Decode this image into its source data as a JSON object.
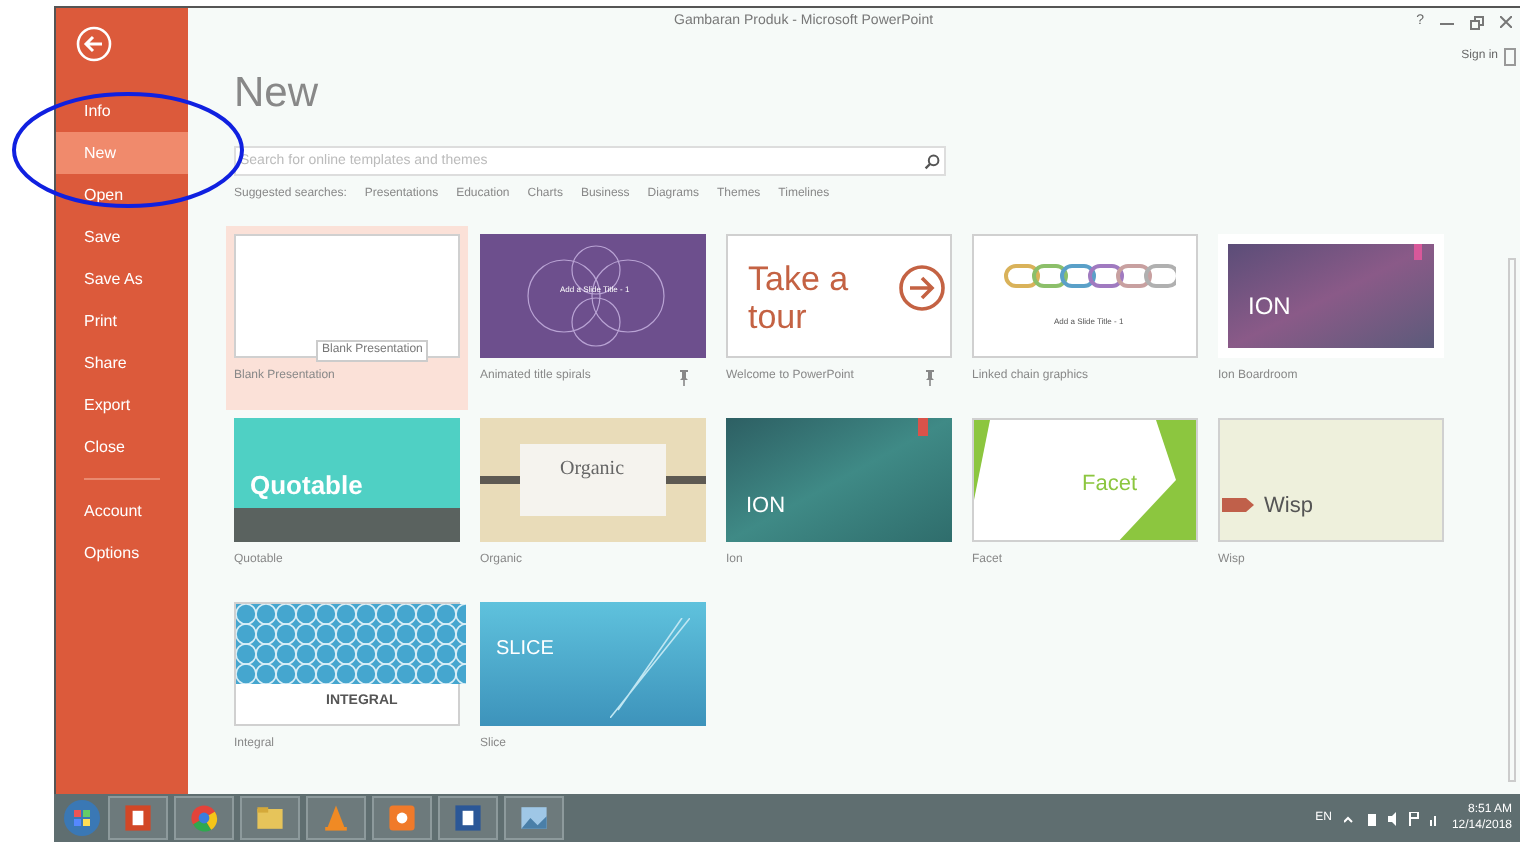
{
  "window": {
    "title": "Gambaran Produk - Microsoft PowerPoint",
    "help": "?",
    "account": "Sign in"
  },
  "sidebar": {
    "items": [
      {
        "label": "Info",
        "selected": false
      },
      {
        "label": "New",
        "selected": true
      },
      {
        "label": "Open",
        "selected": false
      },
      {
        "label": "Save",
        "selected": false
      },
      {
        "label": "Save As",
        "selected": false
      },
      {
        "label": "Print",
        "selected": false
      },
      {
        "label": "Share",
        "selected": false
      },
      {
        "label": "Export",
        "selected": false
      },
      {
        "label": "Close",
        "selected": false
      }
    ],
    "footer_items": [
      {
        "label": "Account",
        "selected": false
      },
      {
        "label": "Options",
        "selected": false
      }
    ]
  },
  "page": {
    "heading": "New",
    "search": {
      "placeholder": "Search for online templates and themes"
    },
    "suggested_label": "Suggested searches:",
    "suggested": [
      "Presentations",
      "Education",
      "Charts",
      "Business",
      "Diagrams",
      "Themes",
      "Timelines"
    ]
  },
  "templates": [
    {
      "name": "Blank Presentation",
      "kind": "blank",
      "selected": true,
      "pinned": false,
      "tooltip": "Blank Presentation"
    },
    {
      "name": "Animated title spirals",
      "kind": "spirals",
      "selected": false,
      "pinned": true,
      "slide_text": "Add a Slide Title - 1"
    },
    {
      "name": "Welcome to PowerPoint",
      "kind": "tour",
      "selected": false,
      "pinned": true,
      "slide_text": "Take a tour"
    },
    {
      "name": "Linked chain graphics",
      "kind": "chain",
      "selected": false,
      "pinned": false,
      "slide_text": "Add a Slide Title - 1"
    },
    {
      "name": "Ion Boardroom",
      "kind": "ion-board",
      "selected": false,
      "pinned": false,
      "slide_text": "ION"
    },
    {
      "name": "Quotable",
      "kind": "quotable",
      "selected": false,
      "pinned": false,
      "slide_text": "Quotable"
    },
    {
      "name": "Organic",
      "kind": "organic",
      "selected": false,
      "pinned": false,
      "slide_text": "Organic"
    },
    {
      "name": "Ion",
      "kind": "ion",
      "selected": false,
      "pinned": false,
      "slide_text": "ION"
    },
    {
      "name": "Facet",
      "kind": "facet",
      "selected": false,
      "pinned": false,
      "slide_text": "Facet"
    },
    {
      "name": "Wisp",
      "kind": "wisp",
      "selected": false,
      "pinned": false,
      "slide_text": "Wisp"
    },
    {
      "name": "Integral",
      "kind": "integral",
      "selected": false,
      "pinned": false,
      "slide_text": "INTEGRAL"
    },
    {
      "name": "Slice",
      "kind": "slice",
      "selected": false,
      "pinned": false,
      "slide_text": "SLICE"
    }
  ],
  "taskbar": {
    "apps": [
      {
        "kind": "powerpoint"
      },
      {
        "kind": "chrome"
      },
      {
        "kind": "folder"
      },
      {
        "kind": "cone"
      },
      {
        "kind": "antivirus"
      },
      {
        "kind": "word"
      },
      {
        "kind": "photos"
      }
    ],
    "language": "EN",
    "time": "8:51 AM",
    "date": "12/14/2018"
  }
}
